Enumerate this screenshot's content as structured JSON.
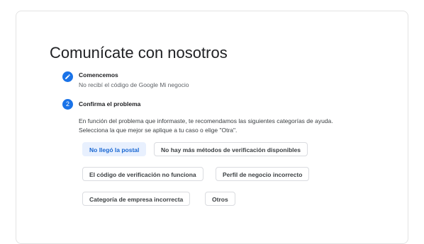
{
  "page": {
    "title": "Comunícate con nosotros"
  },
  "steps": [
    {
      "number": "",
      "icon": "pencil-icon",
      "title": "Comencemos",
      "subtitle": "No recibí el código de Google Mi negocio"
    },
    {
      "number": "2",
      "title": "Confirma el problema",
      "description": "En función del problema que informaste, te recomendamos las siguientes categorías de ayuda. Selecciona la que mejor se aplique a tu caso o elige \"Otra\"."
    }
  ],
  "options": [
    {
      "label": "No llegó la postal",
      "selected": true
    },
    {
      "label": "No hay más métodos de verificación disponibles",
      "selected": false
    },
    {
      "label": "El código de verificación no funciona",
      "selected": false
    },
    {
      "label": "Perfil de negocio incorrecto",
      "selected": false
    },
    {
      "label": "Categoría de empresa incorrecta",
      "selected": false
    },
    {
      "label": "Otros",
      "selected": false
    }
  ],
  "colors": {
    "accent": "#1a73e8",
    "selected_bg": "#e8f0fe",
    "selected_text": "#1967d2"
  }
}
